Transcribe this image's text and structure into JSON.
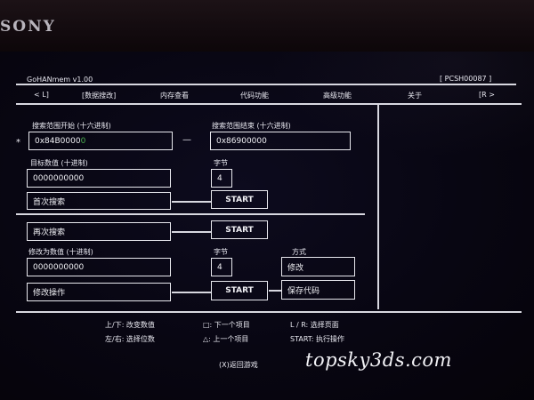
{
  "device": {
    "brand": "SONY"
  },
  "header": {
    "app_title": "GoHANmem v1.00",
    "game_id": "[ PCSH00087 ]"
  },
  "tabs": {
    "left_hint": "< L]",
    "items": [
      "[数据搜改]",
      "内存查看",
      "代码功能",
      "高级功能",
      "关于"
    ],
    "right_hint": "[R >"
  },
  "search": {
    "range_start_label": "搜索范围开始 (十六进制)",
    "range_start_marker": "*",
    "range_start_value": "0x84B0000",
    "range_start_cursor": "0",
    "range_dash": "—",
    "range_end_label": "搜索范围结束 (十六进制)",
    "range_end_value": "0x86900000",
    "target_label": "目标数值 (十进制)",
    "target_value": "0000000000",
    "byte_label": "字节",
    "byte_value": "4",
    "first_search_label": "首次搜索",
    "start_label": "START"
  },
  "research": {
    "again_search_label": "再次搜索",
    "start_label": "START"
  },
  "modify": {
    "modify_label": "修改为数值 (十进制)",
    "modify_value": "0000000000",
    "byte_label": "字节",
    "byte_value": "4",
    "mode_label": "方式",
    "mode_value": "修改",
    "operate_label": "修改操作",
    "start_label": "START",
    "save_code_label": "保存代码"
  },
  "help": {
    "updown": "上/下: 改变数值",
    "leftright": "左/右: 选择位数",
    "square": "□: 下一个项目",
    "triangle": "△: 上一个项目",
    "lr": "L / R: 选择页面",
    "start": "START: 执行操作",
    "back": "(X)返回游戏"
  },
  "watermark": "topsky3ds.com"
}
